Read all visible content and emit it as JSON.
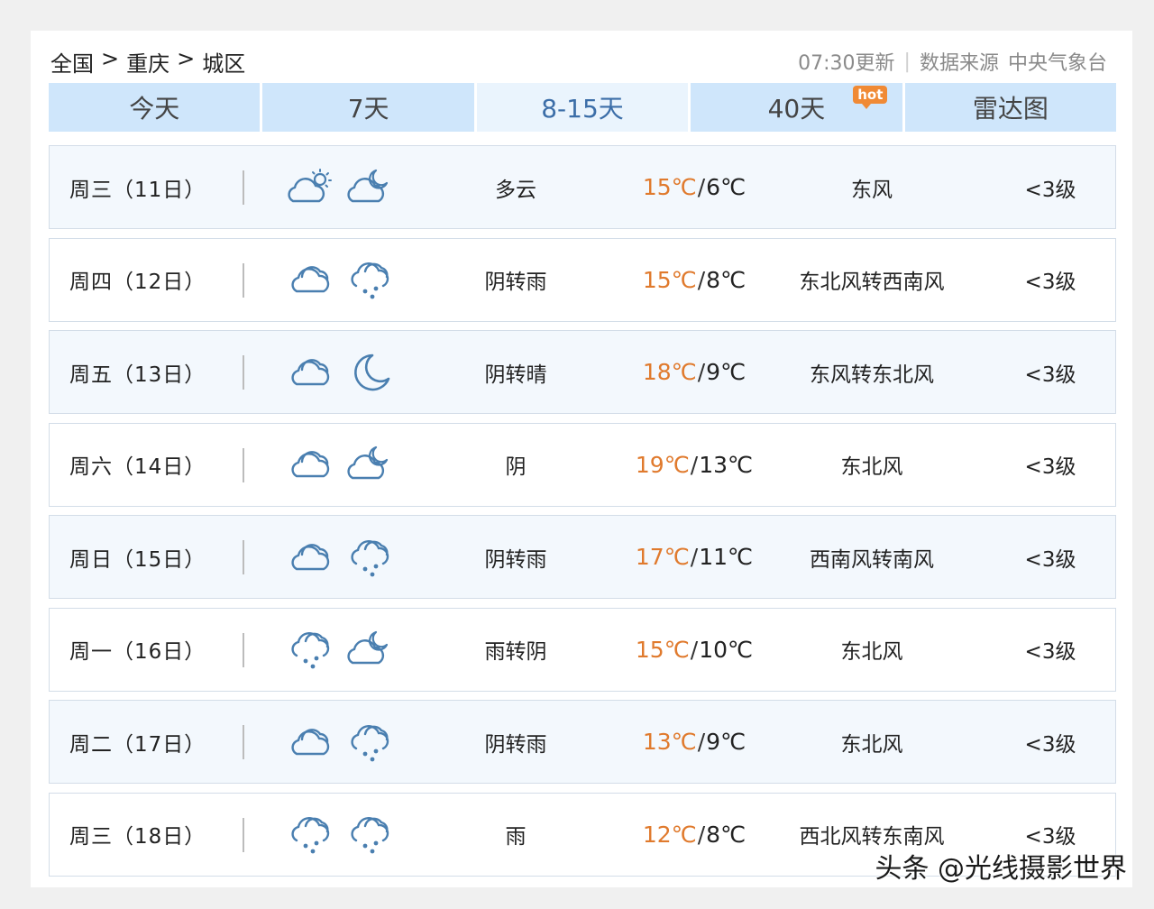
{
  "breadcrumb": [
    "全国",
    "重庆",
    "城区"
  ],
  "breadcrumb_sep": ">",
  "meta": {
    "update": "07:30更新",
    "divider": "|",
    "source_label": "数据来源",
    "source": "中央气象台"
  },
  "tabs": [
    {
      "label": "今天"
    },
    {
      "label": "7天"
    },
    {
      "label": "8-15天",
      "active": true
    },
    {
      "label": "40天",
      "badge": "hot"
    },
    {
      "label": "雷达图"
    }
  ],
  "forecast": [
    {
      "day": "周三（11日）",
      "icons": [
        "cloud-sun-icon",
        "cloud-moon-icon"
      ],
      "cond": "多云",
      "hi": "15℃",
      "lo": "6℃",
      "wind": "东风",
      "level": "<3级"
    },
    {
      "day": "周四（12日）",
      "icons": [
        "cloud-icon",
        "cloud-rain-icon"
      ],
      "cond": "阴转雨",
      "hi": "15℃",
      "lo": "8℃",
      "wind": "东北风转西南风",
      "level": "<3级"
    },
    {
      "day": "周五（13日）",
      "icons": [
        "cloud-icon",
        "moon-icon"
      ],
      "cond": "阴转晴",
      "hi": "18℃",
      "lo": "9℃",
      "wind": "东风转东北风",
      "level": "<3级"
    },
    {
      "day": "周六（14日）",
      "icons": [
        "cloud-icon",
        "cloud-moon-icon"
      ],
      "cond": "阴",
      "hi": "19℃",
      "lo": "13℃",
      "wind": "东北风",
      "level": "<3级"
    },
    {
      "day": "周日（15日）",
      "icons": [
        "cloud-icon",
        "cloud-rain-icon"
      ],
      "cond": "阴转雨",
      "hi": "17℃",
      "lo": "11℃",
      "wind": "西南风转南风",
      "level": "<3级"
    },
    {
      "day": "周一（16日）",
      "icons": [
        "cloud-rain-icon",
        "cloud-moon-icon"
      ],
      "cond": "雨转阴",
      "hi": "15℃",
      "lo": "10℃",
      "wind": "东北风",
      "level": "<3级"
    },
    {
      "day": "周二（17日）",
      "icons": [
        "cloud-icon",
        "cloud-rain-icon"
      ],
      "cond": "阴转雨",
      "hi": "13℃",
      "lo": "9℃",
      "wind": "东北风",
      "level": "<3级"
    },
    {
      "day": "周三（18日）",
      "icons": [
        "cloud-rain-icon",
        "cloud-rain-icon"
      ],
      "cond": "雨",
      "hi": "12℃",
      "lo": "8℃",
      "wind": "西北风转东南风",
      "level": "<3级"
    }
  ],
  "watermark": "头条 @光线摄影世界",
  "colors": {
    "tab_bg": "#cfe6fb",
    "tab_active_bg": "#eaf4fd",
    "tab_active_text": "#3c6ea8",
    "high_temp": "#e07a2d",
    "hot_badge": "#f08a35",
    "icon_stroke": "#4a7fb0"
  }
}
